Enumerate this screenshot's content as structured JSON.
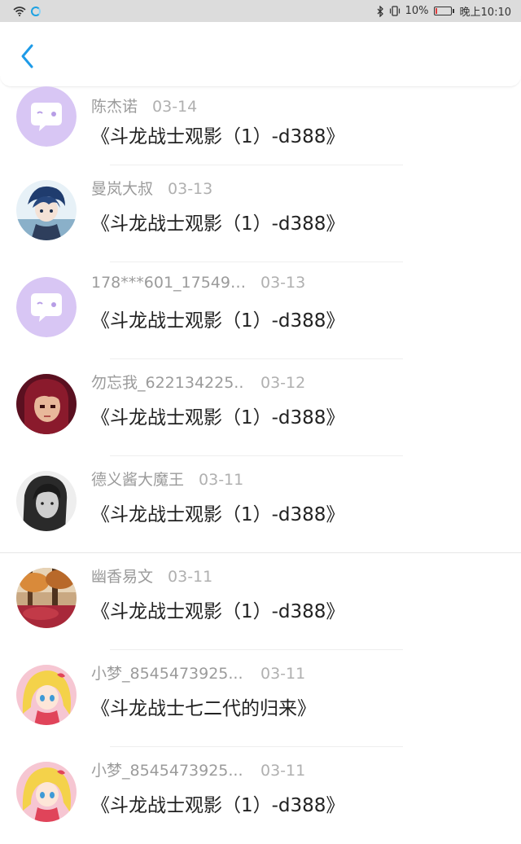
{
  "status_bar": {
    "battery": "10%",
    "time": "晚上10:10",
    "battery_level": 0.1,
    "battery_color": "#e03a3a"
  },
  "header": {
    "back_icon": "chevron-left-icon",
    "accent": "#1e9be8"
  },
  "items": [
    {
      "name": "陈杰诺",
      "date": "03-14",
      "title": "《斗龙战士观影（1）-d388》",
      "avatar": "chat-bubble-avatar"
    },
    {
      "name": "曼岚大叔",
      "date": "03-13",
      "title": "《斗龙战士观影（1）-d388》",
      "avatar": "anime-blue-hair-avatar"
    },
    {
      "name": "178***601_175491..",
      "date": "03-13",
      "title": "《斗龙战士观影（1）-d388》",
      "avatar": "chat-bubble-avatar"
    },
    {
      "name": "勿忘我_622134225..",
      "date": "03-12",
      "title": "《斗龙战士观影（1）-d388》",
      "avatar": "pixel-girl-avatar"
    },
    {
      "name": "德义酱大魔王",
      "date": "03-11",
      "title": "《斗龙战士观影（1）-d388》",
      "avatar": "grayscale-girl-avatar"
    },
    {
      "name": "幽香易文",
      "date": "03-11",
      "title": "《斗龙战士观影（1）-d388》",
      "avatar": "autumn-forest-avatar"
    },
    {
      "name": "小梦_8545473925...",
      "date": "03-11",
      "title": "《斗龙战士七二代的归来》",
      "avatar": "anime-blonde-girl-avatar"
    },
    {
      "name": "小梦_8545473925...",
      "date": "03-11",
      "title": "《斗龙战士观影（1）-d388》",
      "avatar": "anime-blonde-girl-avatar"
    }
  ]
}
